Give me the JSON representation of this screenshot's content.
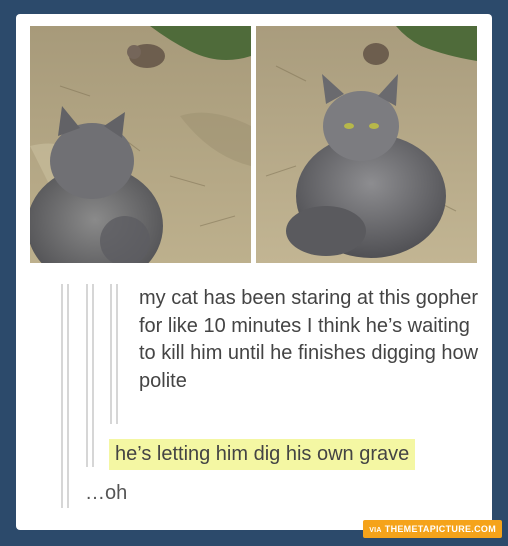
{
  "images": [
    {
      "subject": "cat-looking-at-gopher"
    },
    {
      "subject": "cat-looking-back-with-gopher"
    }
  ],
  "post": {
    "text": "my cat has been staring at this gopher for like 10 minutes I think he’s waiting to kill him until he finishes digging how polite"
  },
  "reply": {
    "text": "he’s letting him dig his own grave",
    "highlight_color": "#f4f7a3"
  },
  "final_reply": {
    "text": "…oh"
  },
  "watermark": {
    "via": "VIA",
    "site": "THEMETAPICTURE.COM"
  },
  "colors": {
    "background": "#2c4a6b",
    "card": "#ffffff",
    "watermark": "#f5a31a"
  }
}
